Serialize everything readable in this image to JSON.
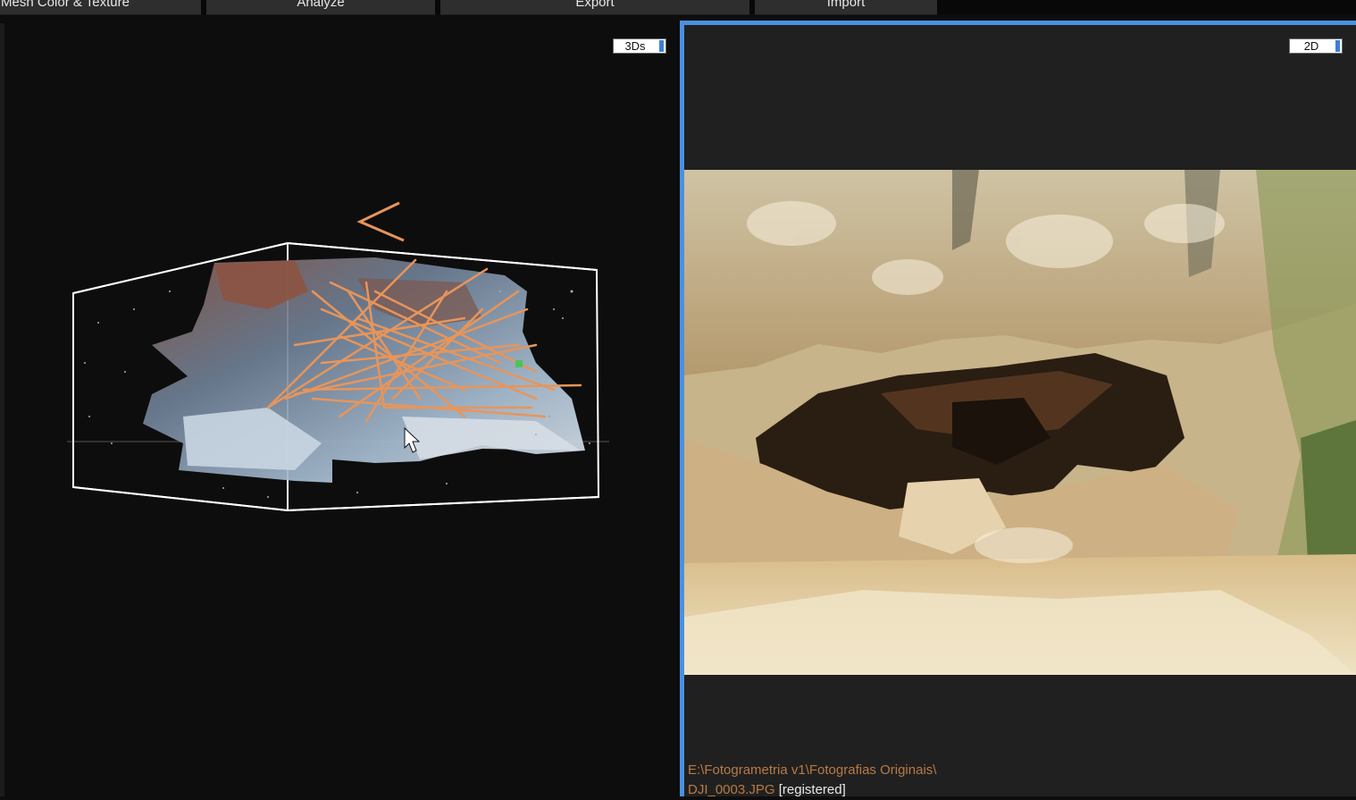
{
  "menu": {
    "tabs": [
      {
        "label": "Mesh Color & Texture"
      },
      {
        "label": "Analyze"
      },
      {
        "label": "Export"
      },
      {
        "label": "Import"
      }
    ]
  },
  "view3d": {
    "mode_label": "3Ds"
  },
  "view2d": {
    "mode_label": "2D",
    "image_path": "E:\\Fotogrametria v1\\Fotografias Originais\\",
    "image_file": "DJI_0003.JPG",
    "image_status": "[registered]"
  },
  "colors": {
    "accent": "#4a90e2",
    "camera_rays": "#e8955a",
    "status_text": "#b97a45",
    "bounding_box": "#ffffff"
  }
}
